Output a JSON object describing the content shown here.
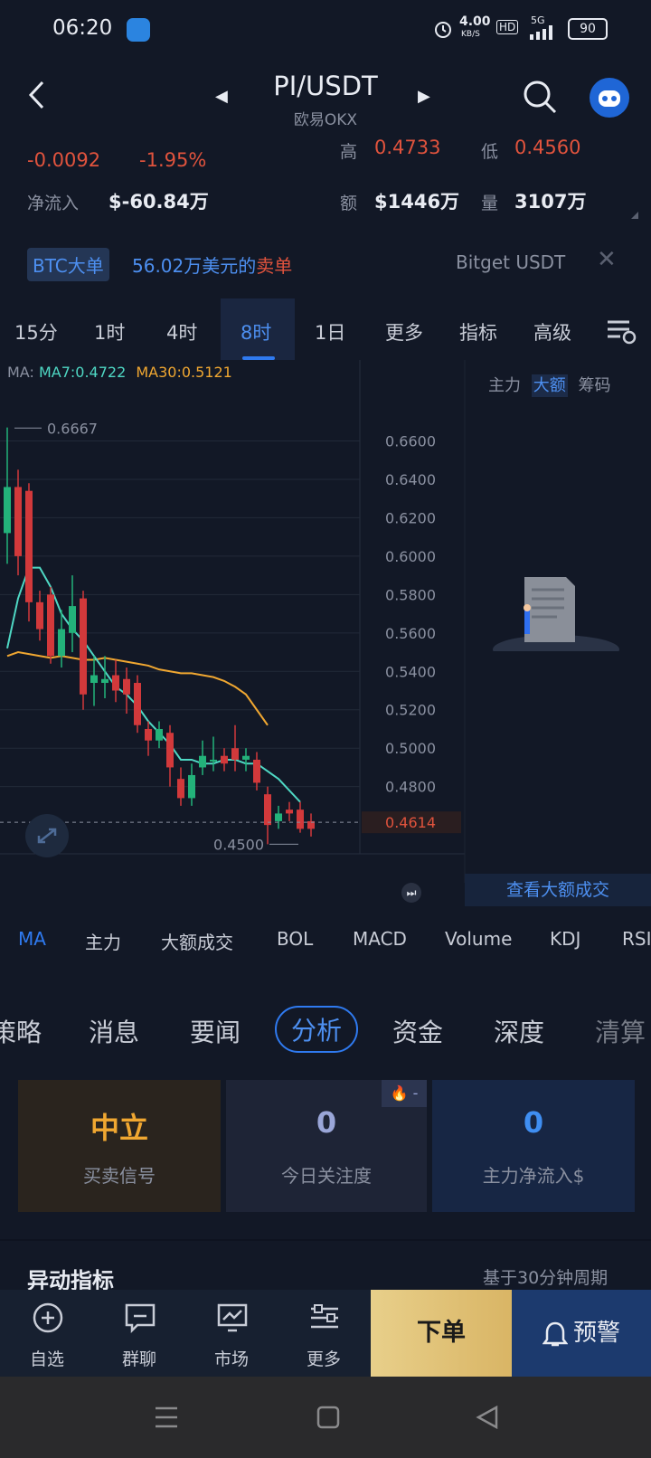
{
  "status_bar": {
    "time": "06:20",
    "net_speed_value": "4.00",
    "net_speed_unit": "KB/S",
    "hd": "HD",
    "signal": "5G",
    "battery": "90"
  },
  "header": {
    "pair": "PI/USDT",
    "exchange": "欧易OKX",
    "back_icon": "back-arrow-icon",
    "search_icon": "search-icon",
    "bot_icon": "robot-avatar-icon"
  },
  "stats": {
    "change": "-0.0092",
    "change_pct": "-1.95%",
    "net_flow_label": "净流入",
    "net_flow": "$-60.84万",
    "high_label": "高",
    "high": "0.4733",
    "low_label": "低",
    "low": "0.4560",
    "amount_label": "额",
    "amount": "$1446万",
    "volume_label": "量",
    "volume": "3107万"
  },
  "banner": {
    "tag": "BTC大单",
    "text": "56.02万美元的",
    "type": "卖单",
    "source": "Bitget USDT"
  },
  "timeframes": [
    "15分",
    "1时",
    "4时",
    "8时",
    "1日",
    "更多",
    "指标",
    "高级"
  ],
  "active_timeframe": "8时",
  "chart": {
    "ma_label": "MA:",
    "ma7": "MA7:0.4722",
    "ma30": "MA30:0.5121",
    "high_marker": "0.6667",
    "low_marker": "0.4500",
    "current_price": "0.4614",
    "side_tabs": [
      "主力",
      "大额",
      "筹码"
    ],
    "view_big_trades": "查看大额成交",
    "colors": {
      "up": "#23b27a",
      "down": "#d2393b",
      "ma7": "#4fd8c4",
      "ma30": "#f0a731",
      "current": "#e0533d"
    }
  },
  "chart_data": {
    "type": "candlestick",
    "title": "",
    "y_ticks": [
      "0.6600",
      "0.6400",
      "0.6200",
      "0.6000",
      "0.5800",
      "0.5600",
      "0.5400",
      "0.5200",
      "0.5000",
      "0.4800"
    ],
    "ylim": [
      0.445,
      0.672
    ],
    "candles": [
      {
        "o": 0.612,
        "c": 0.636,
        "h": 0.667,
        "l": 0.596
      },
      {
        "o": 0.636,
        "c": 0.6,
        "h": 0.645,
        "l": 0.59
      },
      {
        "o": 0.634,
        "c": 0.576,
        "h": 0.638,
        "l": 0.566
      },
      {
        "o": 0.576,
        "c": 0.562,
        "h": 0.582,
        "l": 0.556
      },
      {
        "o": 0.58,
        "c": 0.548,
        "h": 0.584,
        "l": 0.544
      },
      {
        "o": 0.548,
        "c": 0.562,
        "h": 0.572,
        "l": 0.542
      },
      {
        "o": 0.56,
        "c": 0.574,
        "h": 0.59,
        "l": 0.55
      },
      {
        "o": 0.578,
        "c": 0.528,
        "h": 0.582,
        "l": 0.52
      },
      {
        "o": 0.534,
        "c": 0.538,
        "h": 0.548,
        "l": 0.522
      },
      {
        "o": 0.534,
        "c": 0.536,
        "h": 0.548,
        "l": 0.526
      },
      {
        "o": 0.538,
        "c": 0.53,
        "h": 0.546,
        "l": 0.524
      },
      {
        "o": 0.536,
        "c": 0.528,
        "h": 0.542,
        "l": 0.518
      },
      {
        "o": 0.534,
        "c": 0.512,
        "h": 0.538,
        "l": 0.508
      },
      {
        "o": 0.51,
        "c": 0.504,
        "h": 0.514,
        "l": 0.496
      },
      {
        "o": 0.504,
        "c": 0.51,
        "h": 0.514,
        "l": 0.5
      },
      {
        "o": 0.508,
        "c": 0.49,
        "h": 0.512,
        "l": 0.48
      },
      {
        "o": 0.484,
        "c": 0.474,
        "h": 0.49,
        "l": 0.47
      },
      {
        "o": 0.474,
        "c": 0.486,
        "h": 0.492,
        "l": 0.47
      },
      {
        "o": 0.49,
        "c": 0.496,
        "h": 0.504,
        "l": 0.486
      },
      {
        "o": 0.494,
        "c": 0.494,
        "h": 0.506,
        "l": 0.488
      },
      {
        "o": 0.496,
        "c": 0.492,
        "h": 0.5,
        "l": 0.488
      },
      {
        "o": 0.5,
        "c": 0.494,
        "h": 0.512,
        "l": 0.488
      },
      {
        "o": 0.494,
        "c": 0.496,
        "h": 0.5,
        "l": 0.488
      },
      {
        "o": 0.494,
        "c": 0.482,
        "h": 0.498,
        "l": 0.478
      },
      {
        "o": 0.476,
        "c": 0.46,
        "h": 0.48,
        "l": 0.45
      },
      {
        "o": 0.462,
        "c": 0.466,
        "h": 0.47,
        "l": 0.458
      },
      {
        "o": 0.468,
        "c": 0.466,
        "h": 0.472,
        "l": 0.462
      },
      {
        "o": 0.468,
        "c": 0.458,
        "h": 0.472,
        "l": 0.456
      },
      {
        "o": 0.462,
        "c": 0.458,
        "h": 0.466,
        "l": 0.454
      }
    ],
    "ma7": [
      0.552,
      0.578,
      0.594,
      0.594,
      0.584,
      0.57,
      0.562,
      0.556,
      0.548,
      0.54,
      0.532,
      0.528,
      0.522,
      0.514,
      0.508,
      0.502,
      0.494,
      0.494,
      0.492,
      0.492,
      0.494,
      0.494,
      0.492,
      0.492,
      0.488,
      0.484,
      0.478,
      0.472
    ],
    "ma30": [
      0.548,
      0.55,
      0.549,
      0.548,
      0.547,
      0.548,
      0.547,
      0.546,
      0.546,
      0.547,
      0.546,
      0.545,
      0.544,
      0.543,
      0.541,
      0.54,
      0.539,
      0.539,
      0.538,
      0.537,
      0.535,
      0.532,
      0.528,
      0.52,
      0.512
    ]
  },
  "indicator_tabs": [
    "MA",
    "主力",
    "大额成交",
    "BOLL",
    "MACD",
    "Volume",
    "KDJ",
    "RSI"
  ],
  "section_tabs": [
    "策略",
    "消息",
    "要闻",
    "分析",
    "资金",
    "深度",
    "清算"
  ],
  "active_section": "分析",
  "cards": [
    {
      "value": "中立",
      "label": "买卖信号",
      "color": "#f0a731"
    },
    {
      "value": "0",
      "label": "今日关注度",
      "color": "#9aa6d8"
    },
    {
      "value": "0",
      "label": "主力净流入$",
      "color": "#3f8ef2"
    }
  ],
  "abnormal": {
    "title": "异动指标",
    "period": "基于30分钟周期"
  },
  "bottom_nav": [
    {
      "label": "自选",
      "icon": "add-favorite-icon"
    },
    {
      "label": "群聊",
      "icon": "chat-icon"
    },
    {
      "label": "市场",
      "icon": "market-icon"
    },
    {
      "label": "更多",
      "icon": "more-icon"
    }
  ],
  "order_button": "下单",
  "alert_button": "预警"
}
